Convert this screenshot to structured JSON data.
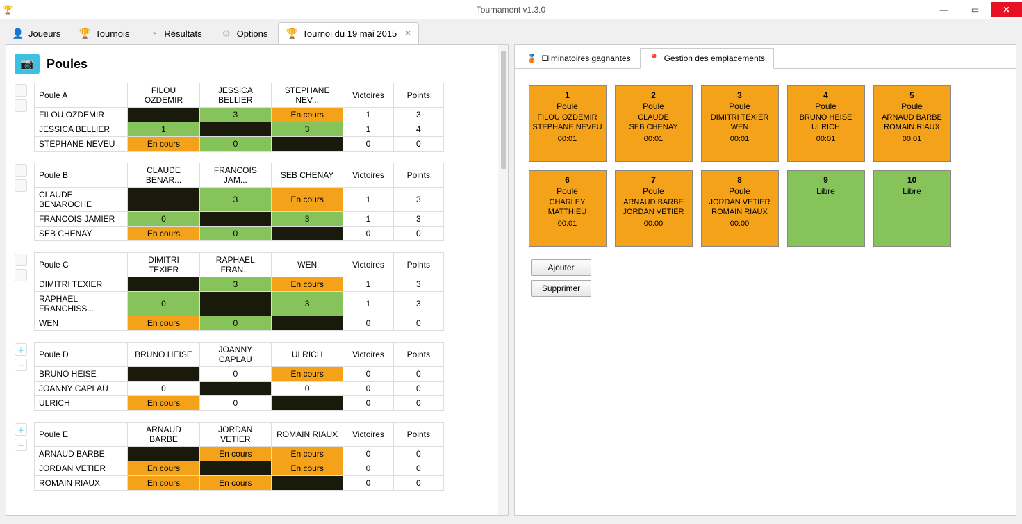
{
  "window": {
    "title": "Tournament v1.3.0"
  },
  "tabs": {
    "players": "Joueurs",
    "tournaments": "Tournois",
    "results": "Résultats",
    "options": "Options",
    "current": "Tournoi du 19 mai 2015"
  },
  "left": {
    "title": "Poules",
    "cols": {
      "wins": "Victoires",
      "pts": "Points"
    },
    "encours": "En cours",
    "poules": [
      {
        "name": "Poule A",
        "side": "blank",
        "headers": [
          "FILOU OZDEMIR",
          "JESSICA BELLIER",
          "STEPHANE NEV..."
        ],
        "rows": [
          {
            "player": "FILOU OZDEMIR",
            "cells": [
              {
                "s": "black"
              },
              {
                "s": "green",
                "v": "3"
              },
              {
                "s": "orange",
                "v": "En cours"
              }
            ],
            "wins": "1",
            "pts": "3"
          },
          {
            "player": "JESSICA BELLIER",
            "cells": [
              {
                "s": "green",
                "v": "1"
              },
              {
                "s": "black"
              },
              {
                "s": "green",
                "v": "3"
              }
            ],
            "wins": "1",
            "pts": "4"
          },
          {
            "player": "STEPHANE NEVEU",
            "cells": [
              {
                "s": "orange",
                "v": "En cours"
              },
              {
                "s": "green",
                "v": "0"
              },
              {
                "s": "black"
              }
            ],
            "wins": "0",
            "pts": "0"
          }
        ]
      },
      {
        "name": "Poule B",
        "side": "blank",
        "headers": [
          "CLAUDE BENAR...",
          "FRANCOIS JAM...",
          "SEB CHENAY"
        ],
        "rows": [
          {
            "player": "CLAUDE BENAROCHE",
            "cells": [
              {
                "s": "black"
              },
              {
                "s": "green",
                "v": "3"
              },
              {
                "s": "orange",
                "v": "En cours"
              }
            ],
            "wins": "1",
            "pts": "3"
          },
          {
            "player": "FRANCOIS JAMIER",
            "cells": [
              {
                "s": "green",
                "v": "0"
              },
              {
                "s": "black"
              },
              {
                "s": "green",
                "v": "3"
              }
            ],
            "wins": "1",
            "pts": "3"
          },
          {
            "player": "SEB CHENAY",
            "cells": [
              {
                "s": "orange",
                "v": "En cours"
              },
              {
                "s": "green",
                "v": "0"
              },
              {
                "s": "black"
              }
            ],
            "wins": "0",
            "pts": "0"
          }
        ]
      },
      {
        "name": "Poule C",
        "side": "blank",
        "headers": [
          "DIMITRI TEXIER",
          "RAPHAEL FRAN...",
          "WEN"
        ],
        "rows": [
          {
            "player": "DIMITRI TEXIER",
            "cells": [
              {
                "s": "black"
              },
              {
                "s": "green",
                "v": "3"
              },
              {
                "s": "orange",
                "v": "En cours"
              }
            ],
            "wins": "1",
            "pts": "3"
          },
          {
            "player": "RAPHAEL FRANCHISS...",
            "cells": [
              {
                "s": "green",
                "v": "0"
              },
              {
                "s": "black"
              },
              {
                "s": "green",
                "v": "3"
              }
            ],
            "wins": "1",
            "pts": "3"
          },
          {
            "player": "WEN",
            "cells": [
              {
                "s": "orange",
                "v": "En cours"
              },
              {
                "s": "green",
                "v": "0"
              },
              {
                "s": "black"
              }
            ],
            "wins": "0",
            "pts": "0"
          }
        ]
      },
      {
        "name": "Poule D",
        "side": "addrem",
        "headers": [
          "BRUNO HEISE",
          "JOANNY CAPLAU",
          "ULRICH"
        ],
        "rows": [
          {
            "player": "BRUNO HEISE",
            "cells": [
              {
                "s": "black"
              },
              {
                "s": "white",
                "v": "0"
              },
              {
                "s": "orange",
                "v": "En cours"
              }
            ],
            "wins": "0",
            "pts": "0"
          },
          {
            "player": "JOANNY CAPLAU",
            "cells": [
              {
                "s": "white",
                "v": "0"
              },
              {
                "s": "black"
              },
              {
                "s": "white",
                "v": "0"
              }
            ],
            "wins": "0",
            "pts": "0"
          },
          {
            "player": "ULRICH",
            "cells": [
              {
                "s": "orange",
                "v": "En cours"
              },
              {
                "s": "white",
                "v": "0"
              },
              {
                "s": "black"
              }
            ],
            "wins": "0",
            "pts": "0"
          }
        ]
      },
      {
        "name": "Poule E",
        "side": "addrem",
        "headers": [
          "ARNAUD BARBE",
          "JORDAN VETIER",
          "ROMAIN RIAUX"
        ],
        "rows": [
          {
            "player": "ARNAUD BARBE",
            "cells": [
              {
                "s": "black"
              },
              {
                "s": "orange",
                "v": "En cours"
              },
              {
                "s": "orange",
                "v": "En cours"
              }
            ],
            "wins": "0",
            "pts": "0"
          },
          {
            "player": "JORDAN VETIER",
            "cells": [
              {
                "s": "orange",
                "v": "En cours"
              },
              {
                "s": "black"
              },
              {
                "s": "orange",
                "v": "En cours"
              }
            ],
            "wins": "0",
            "pts": "0"
          },
          {
            "player": "ROMAIN RIAUX",
            "cells": [
              {
                "s": "orange",
                "v": "En cours"
              },
              {
                "s": "orange",
                "v": "En cours"
              },
              {
                "s": "black"
              }
            ],
            "wins": "0",
            "pts": "0"
          }
        ]
      }
    ]
  },
  "right": {
    "tabs": {
      "elim": "Eliminatoires gagnantes",
      "slots": "Gestion des emplacements"
    },
    "poule_label": "Poule",
    "free_label": "Libre",
    "btn_add": "Ajouter",
    "btn_del": "Supprimer",
    "slots": [
      {
        "n": "1",
        "state": "busy",
        "p1": "FILOU OZDEMIR",
        "p2": "STEPHANE NEVEU",
        "t": "00:01"
      },
      {
        "n": "2",
        "state": "busy",
        "p1": "CLAUDE",
        "p2": "SEB CHENAY",
        "t": "00:01"
      },
      {
        "n": "3",
        "state": "busy",
        "p1": "DIMITRI TEXIER",
        "p2": "WEN",
        "t": "00:01"
      },
      {
        "n": "4",
        "state": "busy",
        "p1": "BRUNO HEISE",
        "p2": "ULRICH",
        "t": "00:01"
      },
      {
        "n": "5",
        "state": "busy",
        "p1": "ARNAUD BARBE",
        "p2": "ROMAIN RIAUX",
        "t": "00:01"
      },
      {
        "n": "6",
        "state": "busy",
        "p1": "CHARLEY",
        "p2": "MATTHIEU",
        "t": "00:01"
      },
      {
        "n": "7",
        "state": "busy",
        "p1": "ARNAUD BARBE",
        "p2": "JORDAN VETIER",
        "t": "00:00"
      },
      {
        "n": "8",
        "state": "busy",
        "p1": "JORDAN VETIER",
        "p2": "ROMAIN RIAUX",
        "t": "00:00"
      },
      {
        "n": "9",
        "state": "free"
      },
      {
        "n": "10",
        "state": "free"
      }
    ]
  }
}
